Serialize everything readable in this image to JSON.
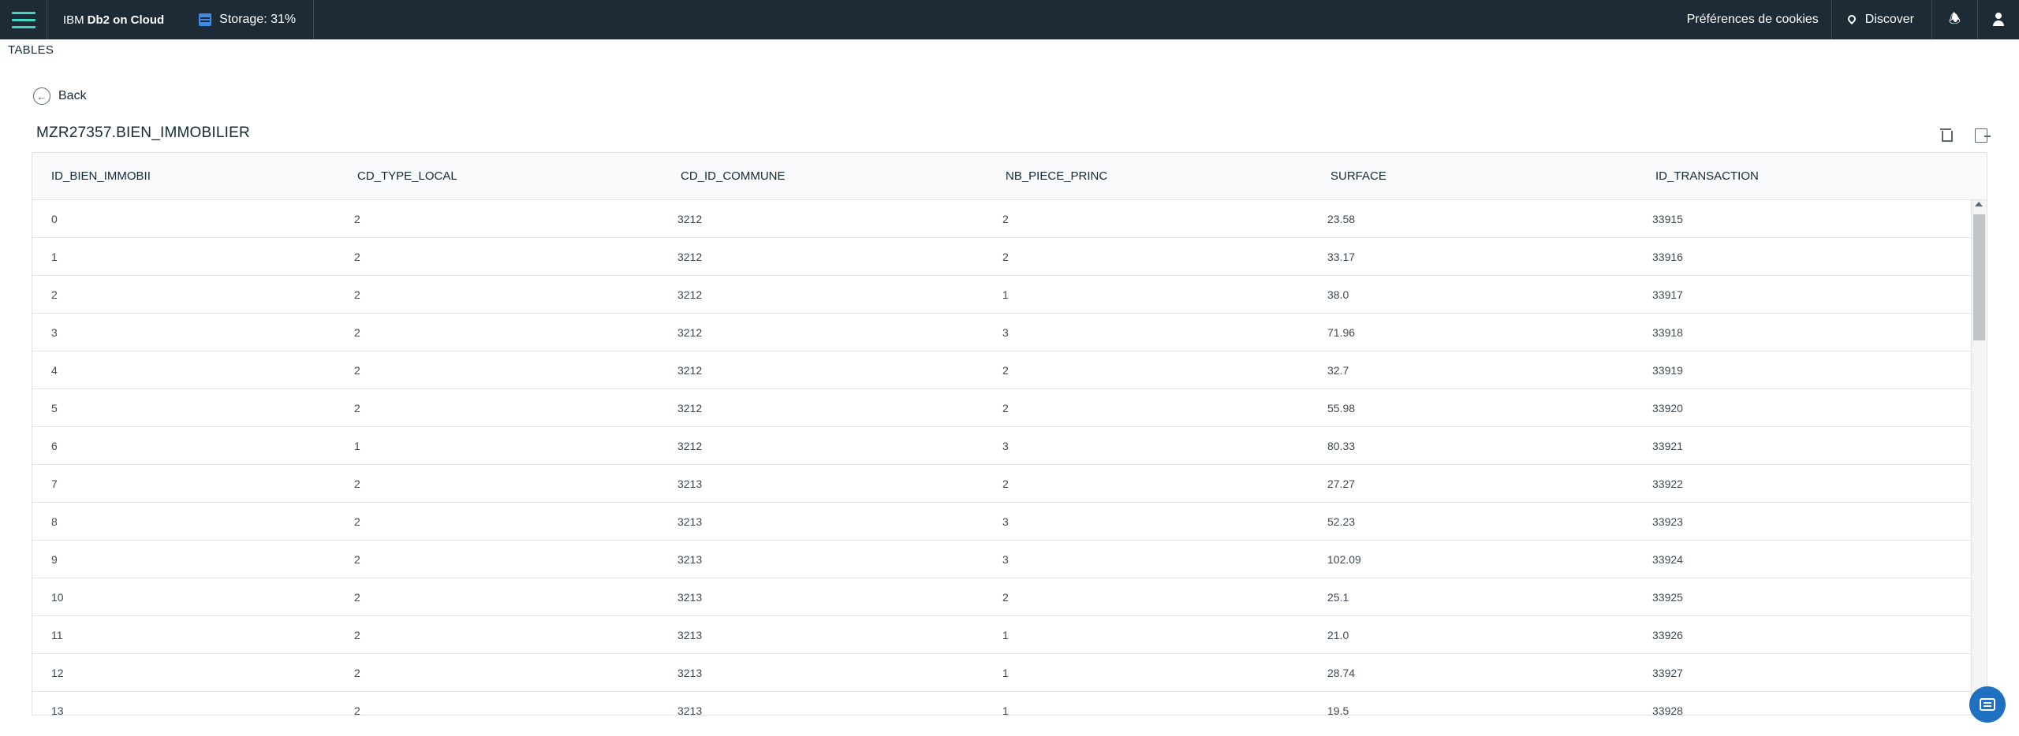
{
  "header": {
    "brand_prefix": "IBM",
    "brand_name": "Db2 on Cloud",
    "storage_label": "Storage: 31%",
    "cookies_label": "Préférences de cookies",
    "discover_label": "Discover"
  },
  "page": {
    "section_label": "TABLES",
    "back_label": "Back",
    "table_name": "MZR27357.BIEN_IMMOBILIER"
  },
  "table": {
    "columns": [
      "ID_BIEN_IMMOBII",
      "CD_TYPE_LOCAL",
      "CD_ID_COMMUNE",
      "NB_PIECE_PRINC",
      "SURFACE",
      "ID_TRANSACTION"
    ],
    "rows": [
      [
        "0",
        "2",
        "3212",
        "2",
        "23.58",
        "33915"
      ],
      [
        "1",
        "2",
        "3212",
        "2",
        "33.17",
        "33916"
      ],
      [
        "2",
        "2",
        "3212",
        "1",
        "38.0",
        "33917"
      ],
      [
        "3",
        "2",
        "3212",
        "3",
        "71.96",
        "33918"
      ],
      [
        "4",
        "2",
        "3212",
        "2",
        "32.7",
        "33919"
      ],
      [
        "5",
        "2",
        "3212",
        "2",
        "55.98",
        "33920"
      ],
      [
        "6",
        "1",
        "3212",
        "3",
        "80.33",
        "33921"
      ],
      [
        "7",
        "2",
        "3213",
        "2",
        "27.27",
        "33922"
      ],
      [
        "8",
        "2",
        "3213",
        "3",
        "52.23",
        "33923"
      ],
      [
        "9",
        "2",
        "3213",
        "3",
        "102.09",
        "33924"
      ],
      [
        "10",
        "2",
        "3213",
        "2",
        "25.1",
        "33925"
      ],
      [
        "11",
        "2",
        "3213",
        "1",
        "21.0",
        "33926"
      ],
      [
        "12",
        "2",
        "3213",
        "1",
        "28.74",
        "33927"
      ],
      [
        "13",
        "2",
        "3213",
        "1",
        "19.5",
        "33928"
      ]
    ]
  },
  "icons": {
    "menu": "hamburger-menu-icon",
    "storage": "database-icon",
    "discover": "location-pin-icon",
    "notifications": "bell-icon",
    "user": "user-icon",
    "back": "arrow-left-circle-icon",
    "delete": "trash-icon",
    "export": "export-icon",
    "chat": "chat-icon"
  },
  "colors": {
    "topbar": "#1d2b36",
    "accent": "#41d6c3",
    "primary": "#1f70c1"
  }
}
